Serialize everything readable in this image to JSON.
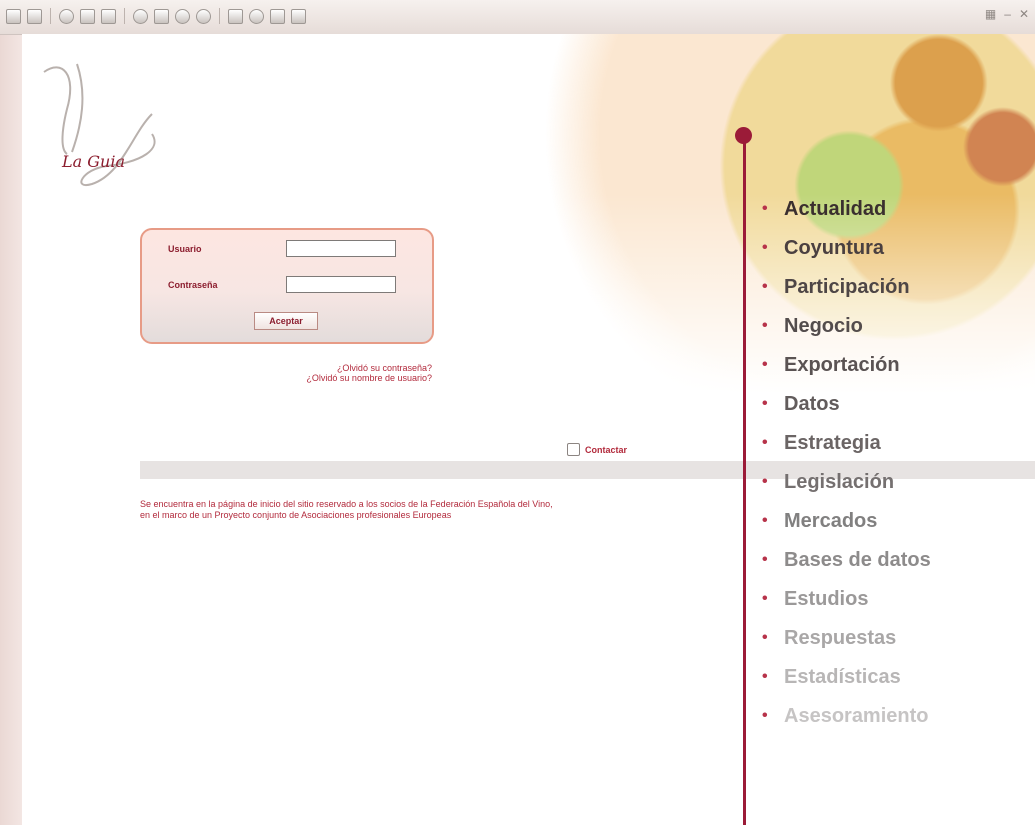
{
  "toolbar": {
    "icons": [
      "back-icon",
      "forward-icon",
      "stop-icon",
      "refresh-icon",
      "home-icon",
      "search-icon",
      "favorites-icon",
      "history-icon",
      "mail-icon",
      "print-icon",
      "edit-icon",
      "discuss-icon",
      "messenger-icon"
    ],
    "right_icons": [
      "throbber-icon",
      "minimize-icon",
      "close-icon"
    ]
  },
  "logo": {
    "text": "La Guia"
  },
  "login": {
    "username_label": "Usuario",
    "password_label": "Contraseña",
    "username_value": "",
    "password_value": "",
    "submit_label": "Aceptar",
    "forgot_password": "¿Olvidó su contraseña?",
    "forgot_username": "¿Olvidó su nombre de usuario?"
  },
  "contact": {
    "label": "Contactar"
  },
  "info_text": "Se encuentra en la página de inicio del sitio reservado a los socios de la Federación Española del Vino, en el marco de un Proyecto conjunto de Asociaciones profesionales Europeas",
  "nav": {
    "items": [
      {
        "label": "Actualidad",
        "color": "#3a2f2f"
      },
      {
        "label": "Coyuntura",
        "color": "#4a4040"
      },
      {
        "label": "Participación",
        "color": "#4e4646"
      },
      {
        "label": "Negocio",
        "color": "#534c4c"
      },
      {
        "label": "Exportación",
        "color": "#5a5353"
      },
      {
        "label": "Datos",
        "color": "#625c5c"
      },
      {
        "label": "Estrategia",
        "color": "#6b6565"
      },
      {
        "label": "Legislación",
        "color": "#757070"
      },
      {
        "label": "Mercados",
        "color": "#818080"
      },
      {
        "label": "Bases de datos",
        "color": "#8d8b8b"
      },
      {
        "label": "Estudios",
        "color": "#9b9999"
      },
      {
        "label": "Respuestas",
        "color": "#a9a7a7"
      },
      {
        "label": "Estadísticas",
        "color": "#b8b6b6"
      },
      {
        "label": "Asesoramiento",
        "color": "#c6c4c4"
      }
    ]
  },
  "colors": {
    "accent": "#9b1b38",
    "link": "#b22a3c"
  }
}
